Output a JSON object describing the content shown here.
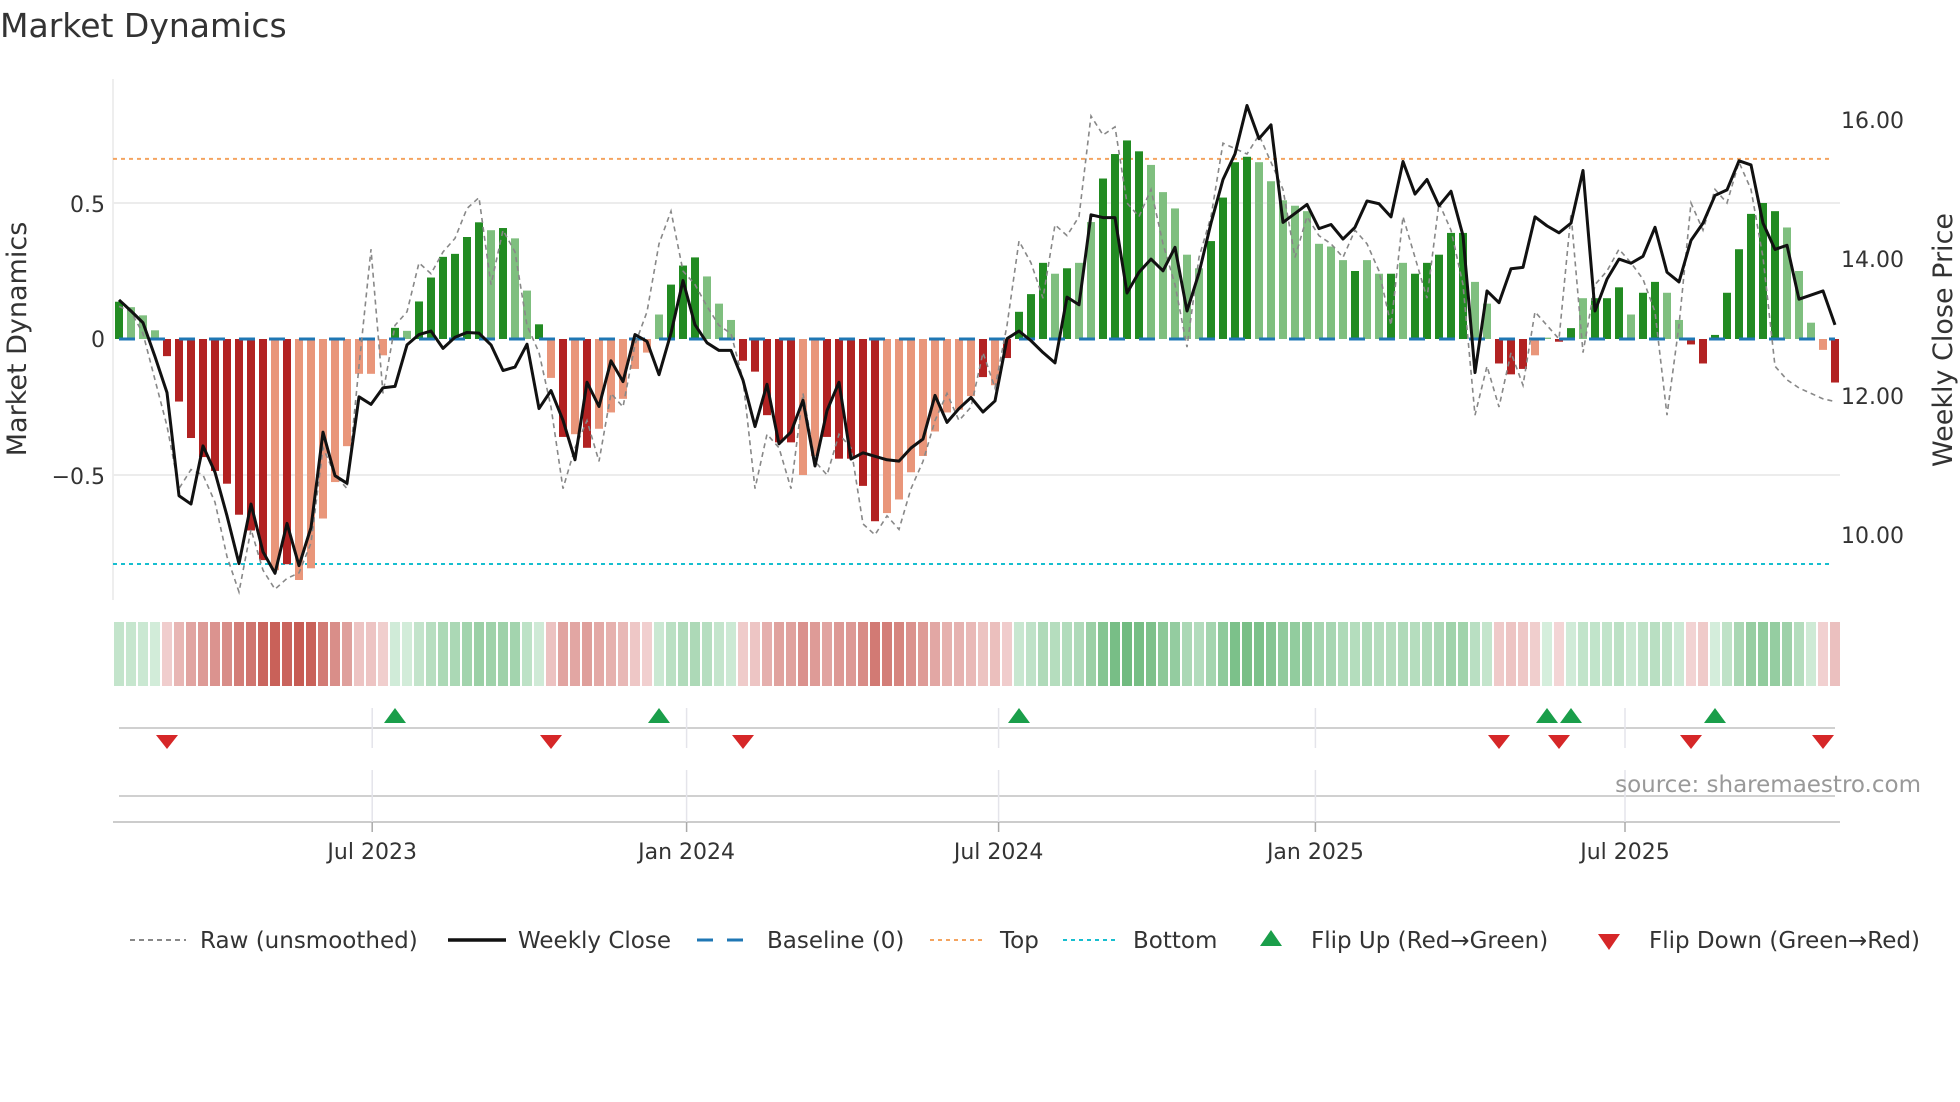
{
  "title": "Market Dynamics",
  "source": "source: sharemaestro.com",
  "chart_data": {
    "type": "bar",
    "title": "Market Dynamics",
    "ylabel": "Market Dynamics",
    "y2label": "Weekly Close Price",
    "ylim": [
      -0.95,
      0.88
    ],
    "y2lim": [
      8.8,
      16.6
    ],
    "yticks": [
      {
        "v": 0.5,
        "label": "0.5"
      },
      {
        "v": 0,
        "label": "0"
      },
      {
        "v": -0.5,
        "label": "−0.5"
      }
    ],
    "y2ticks": [
      {
        "v": 16,
        "label": "16.00"
      },
      {
        "v": 14,
        "label": "14.00"
      },
      {
        "v": 12,
        "label": "12.00"
      },
      {
        "v": 10,
        "label": "10.00"
      }
    ],
    "xticks": [
      {
        "week": 21.1,
        "label": "Jul 2023"
      },
      {
        "week": 47.3,
        "label": "Jan 2024"
      },
      {
        "week": 73.3,
        "label": "Jul 2024"
      },
      {
        "week": 99.7,
        "label": "Jan 2025"
      },
      {
        "week": 125.5,
        "label": "Jul 2025"
      }
    ],
    "top": 0.662,
    "bottom": -0.827,
    "baseline": 0,
    "values": [
      0.137,
      0.117,
      0.087,
      0.032,
      -0.063,
      -0.23,
      -0.364,
      -0.434,
      -0.485,
      -0.532,
      -0.646,
      -0.704,
      -0.813,
      -0.85,
      -0.828,
      -0.886,
      -0.843,
      -0.66,
      -0.526,
      -0.394,
      -0.128,
      -0.128,
      -0.06,
      0.041,
      0.03,
      0.138,
      0.226,
      0.302,
      0.313,
      0.375,
      0.429,
      0.4,
      0.408,
      0.37,
      0.178,
      0.054,
      -0.143,
      -0.36,
      -0.35,
      -0.4,
      -0.33,
      -0.27,
      -0.22,
      -0.11,
      -0.05,
      0.09,
      0.2,
      0.27,
      0.3,
      0.23,
      0.13,
      0.07,
      -0.08,
      -0.12,
      -0.28,
      -0.38,
      -0.38,
      -0.5,
      -0.43,
      -0.36,
      -0.44,
      -0.44,
      -0.54,
      -0.67,
      -0.64,
      -0.59,
      -0.49,
      -0.43,
      -0.34,
      -0.27,
      -0.26,
      -0.21,
      -0.14,
      -0.17,
      -0.07,
      0.1,
      0.165,
      0.28,
      0.24,
      0.26,
      0.28,
      0.43,
      0.59,
      0.68,
      0.73,
      0.69,
      0.64,
      0.54,
      0.48,
      0.31,
      0.26,
      0.36,
      0.52,
      0.65,
      0.67,
      0.65,
      0.58,
      0.51,
      0.49,
      0.47,
      0.35,
      0.34,
      0.29,
      0.25,
      0.29,
      0.24,
      0.24,
      0.28,
      0.24,
      0.28,
      0.31,
      0.39,
      0.39,
      0.21,
      0.13,
      -0.09,
      -0.13,
      -0.11,
      -0.06,
      0.005,
      -0.01,
      0.04,
      0.15,
      0.15,
      0.15,
      0.19,
      0.09,
      0.17,
      0.21,
      0.17,
      0.07,
      -0.02,
      -0.09,
      0.015,
      0.17,
      0.33,
      0.46,
      0.5,
      0.47,
      0.41,
      0.25,
      0.06,
      -0.04,
      -0.16
    ],
    "shade": "dllldddddddddldlllllllldlddddddldlldldldlllllldddllldddddlldddddlllllllldlddddldllddddlllllddddlllllllldlldldddddlldddllddldddlddllddddddddlllldd",
    "raw": [
      0.12,
      0.1,
      0.02,
      -0.15,
      -0.32,
      -0.55,
      -0.48,
      -0.5,
      -0.6,
      -0.8,
      -0.93,
      -0.7,
      -0.85,
      -0.92,
      -0.88,
      -0.86,
      -0.75,
      -0.4,
      -0.5,
      -0.55,
      -0.1,
      0.33,
      -0.2,
      0.05,
      0.1,
      0.28,
      0.24,
      0.32,
      0.37,
      0.48,
      0.52,
      0.2,
      0.4,
      0.32,
      0.05,
      -0.05,
      -0.25,
      -0.55,
      -0.4,
      -0.3,
      -0.45,
      -0.2,
      -0.25,
      -0.02,
      0.1,
      0.35,
      0.47,
      0.25,
      0.2,
      0.12,
      0.05,
      0.02,
      -0.15,
      -0.55,
      -0.35,
      -0.4,
      -0.55,
      -0.2,
      -0.45,
      -0.5,
      -0.35,
      -0.4,
      -0.68,
      -0.72,
      -0.65,
      -0.7,
      -0.55,
      -0.45,
      -0.3,
      -0.2,
      -0.3,
      -0.25,
      -0.05,
      -0.18,
      0.05,
      0.36,
      0.28,
      0.15,
      0.42,
      0.38,
      0.45,
      0.82,
      0.75,
      0.78,
      0.5,
      0.45,
      0.55,
      0.35,
      0.2,
      -0.03,
      0.3,
      0.45,
      0.72,
      0.7,
      0.68,
      0.75,
      0.65,
      0.55,
      0.3,
      0.45,
      0.38,
      0.35,
      0.3,
      0.4,
      0.35,
      0.25,
      0.05,
      0.45,
      0.3,
      0.15,
      0.5,
      0.4,
      0.2,
      -0.28,
      -0.1,
      -0.25,
      -0.05,
      -0.17,
      0.1,
      0.05,
      0.0,
      0.46,
      -0.05,
      0.2,
      0.25,
      0.33,
      0.28,
      0.22,
      0.1,
      -0.28,
      0.05,
      0.5,
      0.4,
      0.55,
      0.5,
      0.65,
      0.55,
      0.3,
      -0.1,
      -0.15,
      -0.18,
      -0.2,
      -0.22,
      -0.23
    ],
    "price": [
      13.4,
      13.24,
      13.07,
      12.58,
      12.06,
      10.57,
      10.45,
      11.29,
      10.91,
      10.28,
      9.59,
      10.45,
      9.76,
      9.45,
      10.17,
      9.56,
      10.11,
      11.49,
      10.86,
      10.75,
      12.0,
      11.89,
      12.13,
      12.15,
      12.75,
      12.9,
      12.95,
      12.7,
      12.86,
      12.93,
      12.92,
      12.75,
      12.38,
      12.43,
      12.76,
      11.83,
      12.09,
      11.66,
      11.09,
      12.21,
      11.86,
      12.52,
      12.22,
      12.9,
      12.8,
      12.32,
      12.92,
      13.68,
      13.04,
      12.78,
      12.67,
      12.67,
      12.24,
      11.57,
      12.18,
      11.32,
      11.49,
      11.95,
      11.0,
      11.8,
      12.21,
      11.1,
      11.19,
      11.14,
      11.09,
      11.07,
      11.26,
      11.39,
      12.02,
      11.63,
      11.83,
      11.99,
      11.78,
      11.94,
      12.84,
      12.95,
      12.81,
      12.64,
      12.49,
      13.44,
      13.33,
      14.63,
      14.59,
      14.59,
      13.5,
      13.8,
      13.99,
      13.82,
      14.16,
      13.24,
      13.79,
      14.51,
      15.14,
      15.51,
      16.21,
      15.73,
      15.93,
      14.52,
      14.65,
      14.78,
      14.43,
      14.49,
      14.28,
      14.45,
      14.83,
      14.79,
      14.6,
      15.4,
      14.93,
      15.14,
      14.76,
      14.97,
      14.33,
      12.35,
      13.53,
      13.36,
      13.85,
      13.87,
      14.6,
      14.47,
      14.37,
      14.51,
      15.27,
      13.24,
      13.7,
      13.99,
      13.93,
      14.03,
      14.45,
      13.8,
      13.66,
      14.26,
      14.51,
      14.91,
      14.99,
      15.41,
      15.35,
      14.51,
      14.13,
      14.19,
      13.41,
      13.47,
      13.53,
      13.04
    ],
    "flip_up": [
      23,
      45,
      75,
      119,
      121,
      133
    ],
    "flip_down": [
      4,
      36,
      52,
      115,
      120,
      131,
      142
    ],
    "legend": {
      "placement": "bottom",
      "items": [
        "Raw (unsmoothed)",
        "Weekly Close",
        "Baseline (0)",
        "Top",
        "Bottom",
        "Flip Up (Red→Green)",
        "Flip Down (Green→Red)"
      ]
    },
    "colors": {
      "up_strong": "#228b22",
      "up_weak": "#7fbf7f",
      "down_strong": "#b22222",
      "down_weak": "#e9967a",
      "top": "#f4a460",
      "bottom": "#17becf",
      "baseline": "#1f77b4",
      "flip_up": "#1a9e4a",
      "flip_down": "#d62728"
    }
  }
}
